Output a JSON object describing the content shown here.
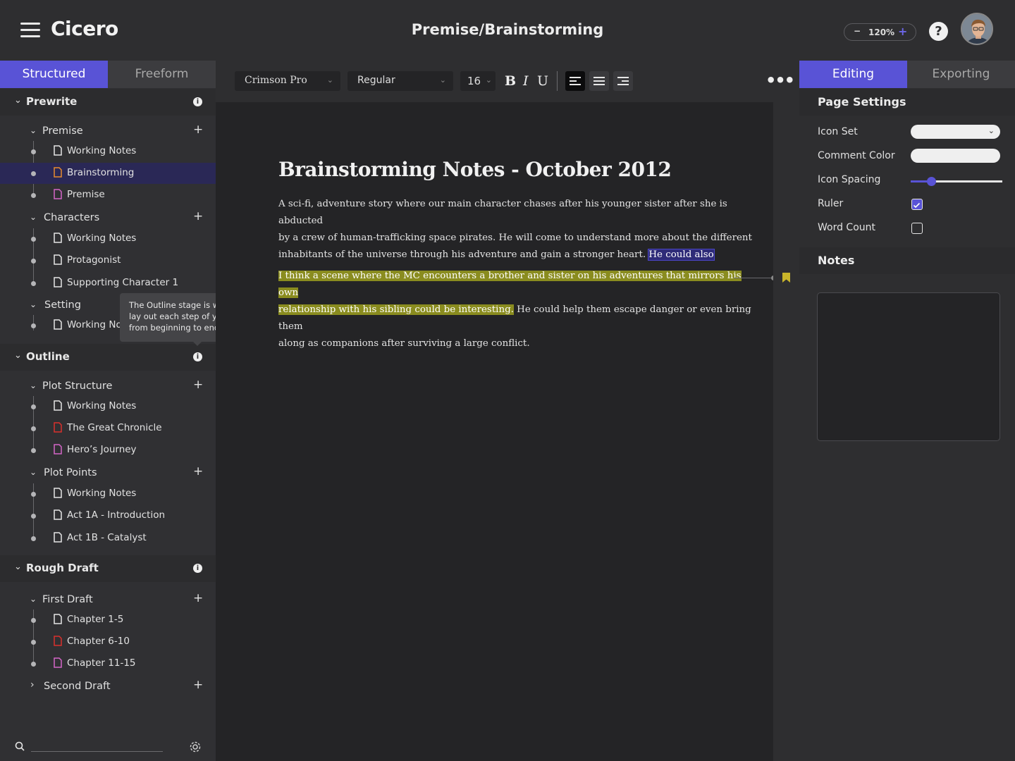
{
  "header": {
    "app_name": "Cicero",
    "document_title": "Premise/Brainstorming",
    "zoom_minus": "−",
    "zoom_value": "120%",
    "zoom_plus": "+",
    "help_label": "?"
  },
  "left_tabs": [
    "Structured",
    "Freeform"
  ],
  "stages": [
    {
      "label": "Prewrite"
    },
    {
      "label": "Outline"
    },
    {
      "label": "Rough Draft"
    }
  ],
  "groups": {
    "premise": "Premise",
    "characters": "Characters",
    "setting": "Setting",
    "plot_structure": "Plot Structure",
    "plot_points": "Plot Points",
    "first_draft": "First Draft",
    "second_draft": "Second Draft",
    "add": "+"
  },
  "items": {
    "premise": [
      {
        "label": "Working Notes",
        "color": "#e6e6e6"
      },
      {
        "label": "Brainstorming",
        "color": "#e88b2e"
      },
      {
        "label": "Premise",
        "color": "#d466c8"
      }
    ],
    "characters": [
      {
        "label": "Working Notes",
        "color": "#e6e6e6"
      },
      {
        "label": "Protagonist",
        "color": "#e6e6e6"
      },
      {
        "label": "Supporting Character 1",
        "color": "#e6e6e6"
      }
    ],
    "setting": [
      {
        "label": "Working Notes",
        "color": "#e6e6e6"
      }
    ],
    "plot_structure": [
      {
        "label": "Working Notes",
        "color": "#e6e6e6"
      },
      {
        "label": "The Great Chronicle",
        "color": "#d9302c"
      },
      {
        "label": "Hero’s Journey",
        "color": "#d466c8"
      }
    ],
    "plot_points": [
      {
        "label": "Working Notes",
        "color": "#e6e6e6"
      },
      {
        "label": "Act 1A - Introduction",
        "color": "#e6e6e6"
      },
      {
        "label": "Act 1B - Catalyst",
        "color": "#e6e6e6"
      }
    ],
    "first_draft": [
      {
        "label": "Chapter 1-5",
        "color": "#e6e6e6"
      },
      {
        "label": "Chapter 6-10",
        "color": "#d9302c"
      },
      {
        "label": "Chapter 11-15",
        "color": "#d466c8"
      }
    ]
  },
  "tooltip": "The Outline stage is where you lay out each step of your story from beginning to end.",
  "toolbar": {
    "font_family": "Crimson Pro",
    "font_weight": "Regular",
    "font_size": "16",
    "bold": "B",
    "italic": "I",
    "underline": "U",
    "more": "•••"
  },
  "document": {
    "heading": "Brainstorming Notes - October 2012",
    "para1_lines": [
      "A sci-fi, adventure story where our main character chases after his younger sister after she is abducted",
      "by a crew of human-trafficking space pirates. He will come to understand more about the different",
      "inhabitants of the universe through his adventure and gain a stronger heart."
    ],
    "para1_selected": "He could also",
    "para2_highlight_1": "I think a scene where the MC encounters a brother and sister on his adventures that mirrors his own",
    "para2_highlight_2": "relationship with his sibling could be interesting.",
    "para2_rest_1": " He could help them escape danger or even bring them",
    "para2_rest_2": "along as companions after surviving a large conflict."
  },
  "right_tabs": [
    "Editing",
    "Exporting"
  ],
  "page_settings": {
    "title": "Page Settings",
    "icon_set": "Icon Set",
    "comment_color": "Comment Color",
    "icon_spacing": "Icon Spacing",
    "icon_spacing_level": 0.22,
    "ruler": "Ruler",
    "ruler_checked": true,
    "word_count": "Word Count",
    "word_count_checked": false
  },
  "notes": {
    "title": "Notes"
  },
  "colors": {
    "accent": "#5953d6",
    "highlight": "#8a8c1f",
    "selection": "#2e2b78"
  }
}
